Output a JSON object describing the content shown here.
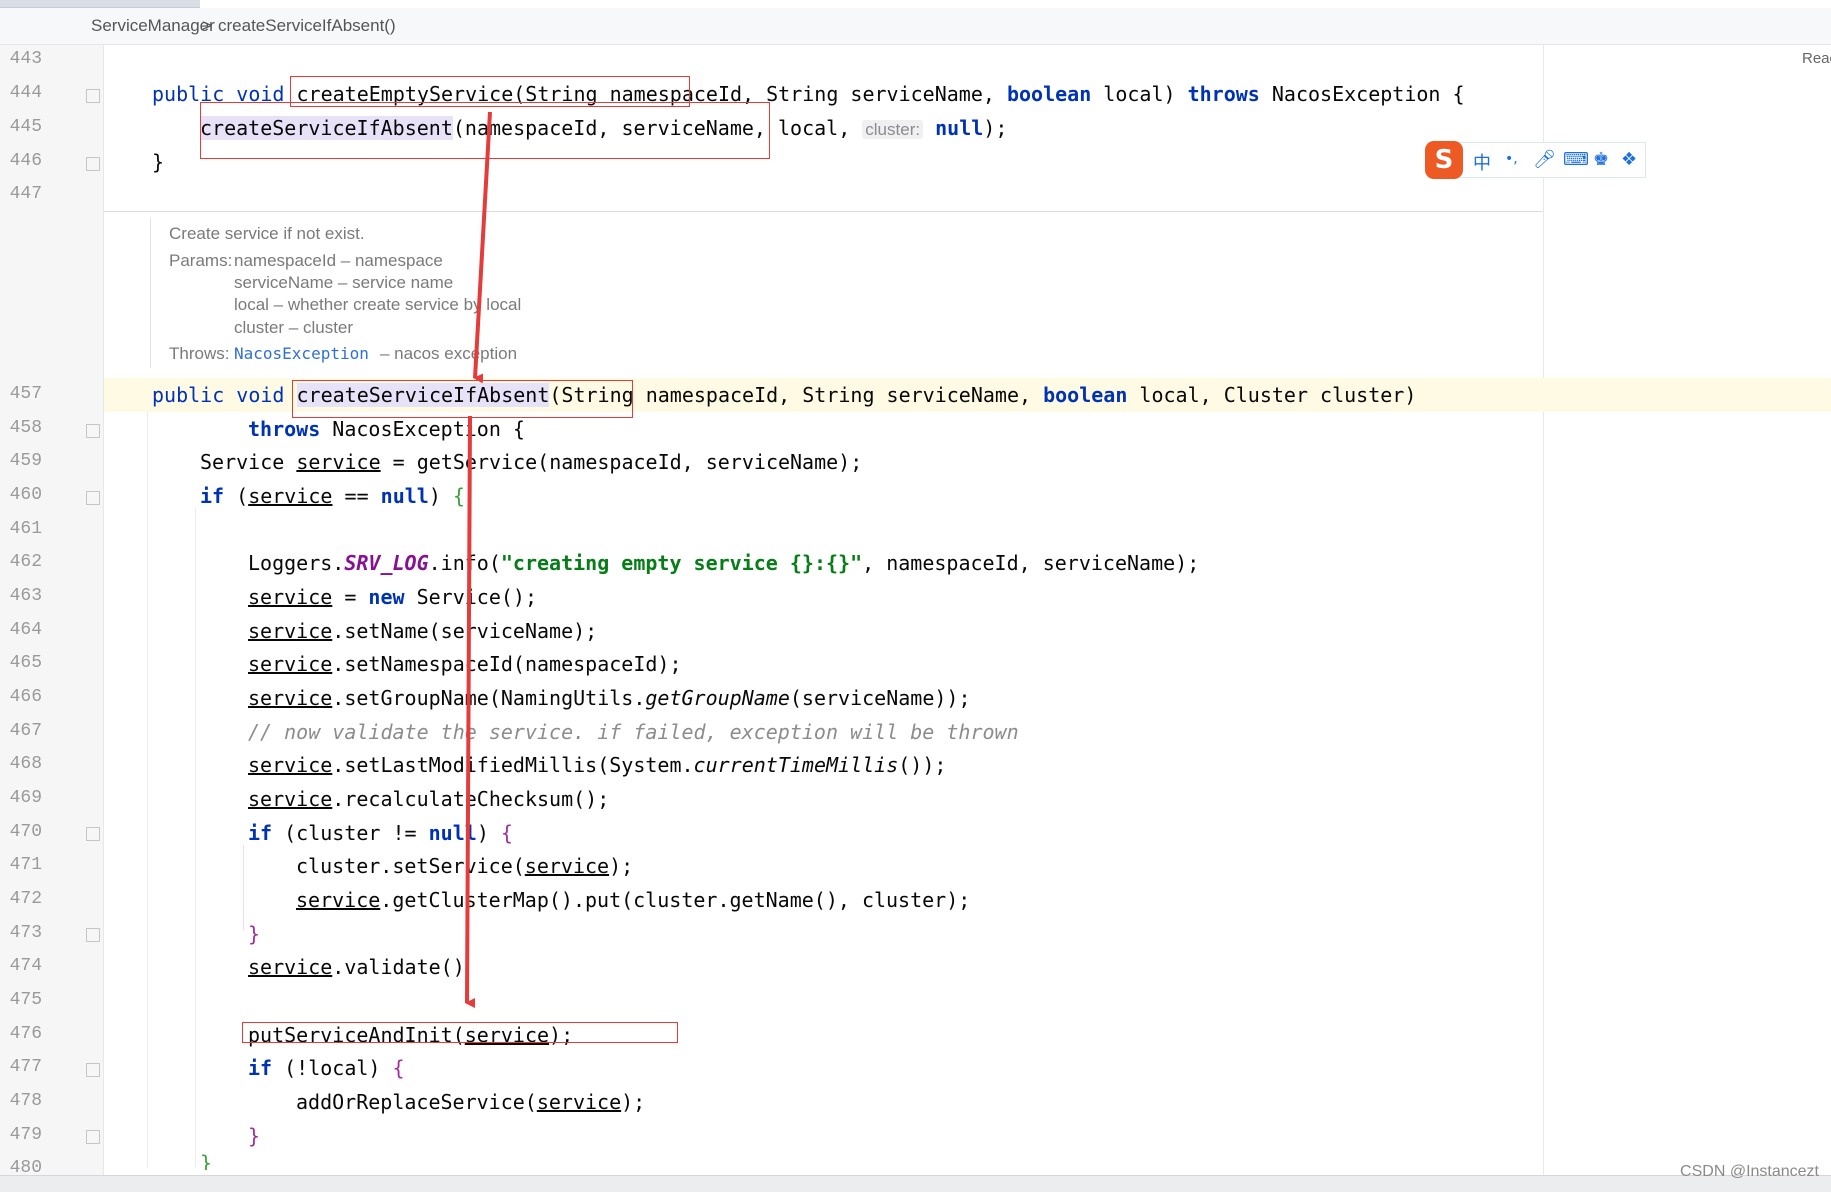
{
  "breadcrumb": {
    "class_name": "ServiceManager",
    "separator": ">",
    "method_name": "createServiceIfAbsent()"
  },
  "reader_mode": "Reac",
  "ime_toolbar": {
    "logo": "S",
    "lang": "中",
    "punct": "•,",
    "icons": [
      "mic-icon",
      "keyboard-icon",
      "skin-icon",
      "apps-icon"
    ]
  },
  "line_numbers": [
    "443",
    "444",
    "445",
    "446",
    "447",
    "457",
    "458",
    "459",
    "460",
    "461",
    "462",
    "463",
    "464",
    "465",
    "466",
    "467",
    "468",
    "469",
    "470",
    "471",
    "472",
    "473",
    "474",
    "475",
    "476",
    "477",
    "478",
    "479",
    "480"
  ],
  "doc": {
    "summary": "Create service if not exist.",
    "params_label": "Params:",
    "params": [
      "namespaceId – namespace",
      "serviceName – service name",
      "local – whether create service by local",
      "cluster – cluster"
    ],
    "throws_label": "Throws:",
    "throws_link": "NacosException",
    "throws_text": "– nacos exception"
  },
  "inlay_hint": "cluster:",
  "watermark": "CSDN @Instancezt",
  "annotation_color": "#e43b3b",
  "code": {
    "l444": {
      "kw1": "public",
      "kw2": "void",
      "name": "createEmptyService",
      "p1": "(String namespaceId, String serviceName, ",
      "kw3": "boolean",
      "p2": " local) ",
      "kw4": "throws",
      "p3": " NacosException {"
    },
    "l445": {
      "call": "createServiceIfAbsent",
      "args": "(namespaceId, serviceName, local, ",
      "nul": "null",
      "end": ");"
    },
    "l446": "}",
    "l457": {
      "kw1": "public",
      "kw2": "void",
      "name": "createServiceIfAbsent",
      "p1": "(String namespaceId, String serviceName, ",
      "kw3": "boolean",
      "p2": " local, Cluster cluster)"
    },
    "l458": {
      "kw": "throws",
      "rest": " NacosException {"
    },
    "l459": {
      "a": "Service ",
      "b": "service",
      "c": " = getService(namespaceId, serviceName);"
    },
    "l460": {
      "kw": "if",
      "a": " (",
      "b": "service",
      "c": " == ",
      "nul": "null",
      "d": ") ",
      "brace": "{"
    },
    "l462": {
      "a": "Loggers.",
      "field": "SRV_LOG",
      "b": ".info(",
      "str": "\"creating empty service {}:{}\"",
      "c": ", namespaceId, serviceName);"
    },
    "l463": {
      "a": "service",
      "b": " = ",
      "kw": "new",
      "c": " Service();"
    },
    "l464": {
      "a": "service",
      "b": ".setName(serviceName);"
    },
    "l465": {
      "a": "service",
      "b": ".setNamespaceId(namespaceId);"
    },
    "l466": {
      "a": "service",
      "b": ".setGroupName(NamingUtils.",
      "ital": "getGroupName",
      "c": "(serviceName));"
    },
    "l467": "// now validate the service. if failed, exception will be thrown",
    "l468": {
      "a": "service",
      "b": ".setLastModifiedMillis(System.",
      "ital": "currentTimeMillis",
      "c": "());"
    },
    "l469": {
      "a": "service",
      "b": ".recalculateChecksum();"
    },
    "l470": {
      "kw": "if",
      "a": " (cluster != ",
      "nul": "null",
      "b": ") ",
      "brace": "{"
    },
    "l471": {
      "a": "cluster.setService(",
      "b": "service",
      "c": ");"
    },
    "l472": {
      "a": "service",
      "b": ".getClusterMap().put(cluster.getName(), cluster);"
    },
    "l473": "}",
    "l474": {
      "a": "service",
      "b": ".validate()"
    },
    "l476": {
      "a": "putServiceAndInit(",
      "b": "service",
      "c": ");"
    },
    "l477": {
      "kw": "if",
      "a": " (!local) ",
      "brace": "{"
    },
    "l478": {
      "a": "addOrReplaceService(",
      "b": "service",
      "c": ");"
    },
    "l479": "}",
    "l480": "}"
  }
}
